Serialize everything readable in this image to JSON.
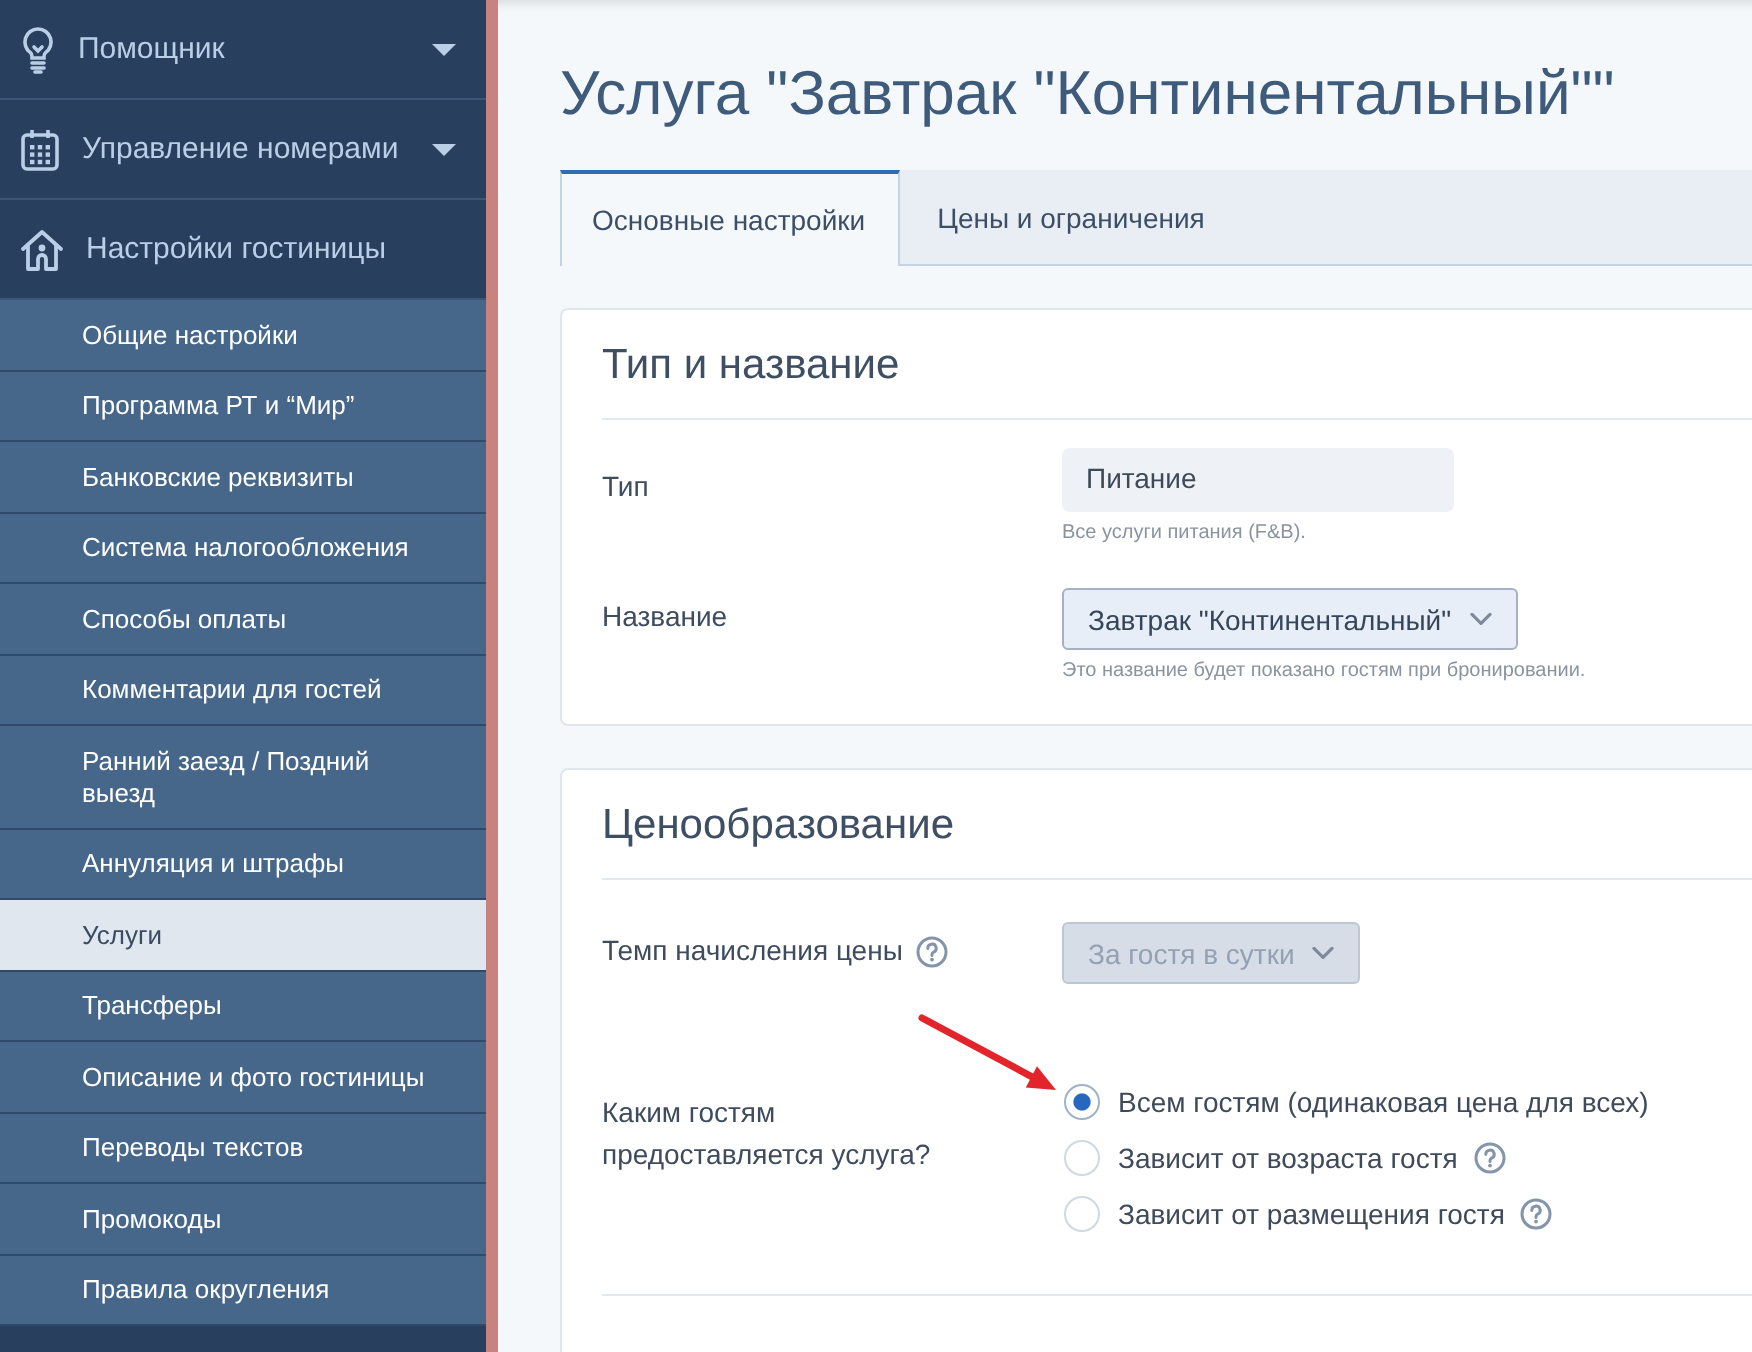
{
  "sidebar": {
    "sections": [
      {
        "label": "Помощник",
        "expanded": false
      },
      {
        "label": "Управление номерами",
        "expanded": false
      },
      {
        "label": "Настройки гостиницы",
        "expanded": true,
        "children": [
          {
            "label": "Общие настройки",
            "selected": false
          },
          {
            "label": "Программа РТ и “Мир”",
            "selected": false
          },
          {
            "label": "Банковские реквизиты",
            "selected": false
          },
          {
            "label": "Система налогообложения",
            "selected": false
          },
          {
            "label": "Способы оплаты",
            "selected": false
          },
          {
            "label": "Комментарии для гостей",
            "selected": false
          },
          {
            "label": "Ранний заезд / Поздний выезд",
            "selected": false
          },
          {
            "label": "Аннуляция и штрафы",
            "selected": false
          },
          {
            "label": "Услуги",
            "selected": true
          },
          {
            "label": "Трансферы",
            "selected": false
          },
          {
            "label": "Описание и фото гостиницы",
            "selected": false
          },
          {
            "label": "Переводы текстов",
            "selected": false
          },
          {
            "label": "Промокоды",
            "selected": false
          },
          {
            "label": "Правила округления",
            "selected": false
          }
        ]
      }
    ]
  },
  "page": {
    "title": "Услуга \"Завтрак \"Континентальный\"\"",
    "tabs": [
      {
        "label": "Основные настройки",
        "selected": true
      },
      {
        "label": "Цены и ограничения",
        "selected": false
      }
    ],
    "cards": [
      {
        "title": "Тип и название",
        "fields": [
          {
            "kind": "readonly",
            "label": "Тип",
            "value": "Питание",
            "hint": "Все услуги питания (F&B)."
          },
          {
            "kind": "select",
            "label": "Название",
            "value": "Завтрак \"Континентальный\"",
            "disabled": false,
            "help": false,
            "hint": "Это название будет показано гостям при бронировании."
          }
        ]
      },
      {
        "title": "Ценообразование",
        "fields": [
          {
            "kind": "select",
            "label": "Темп начисления цены",
            "value": "За гостя в сутки",
            "disabled": true,
            "help": true
          },
          {
            "kind": "radio",
            "label": "Каким гостям предоставляется услуга?",
            "options": [
              {
                "label": "Всем гостям (одинаковая цена для всех)",
                "selected": true,
                "help": false,
                "callout_arrow": true
              },
              {
                "label": "Зависит от возраста гостя",
                "selected": false,
                "help": true,
                "callout_arrow": false
              },
              {
                "label": "Зависит от размещения гостя",
                "selected": false,
                "help": true,
                "callout_arrow": false
              }
            ]
          }
        ]
      }
    ]
  }
}
